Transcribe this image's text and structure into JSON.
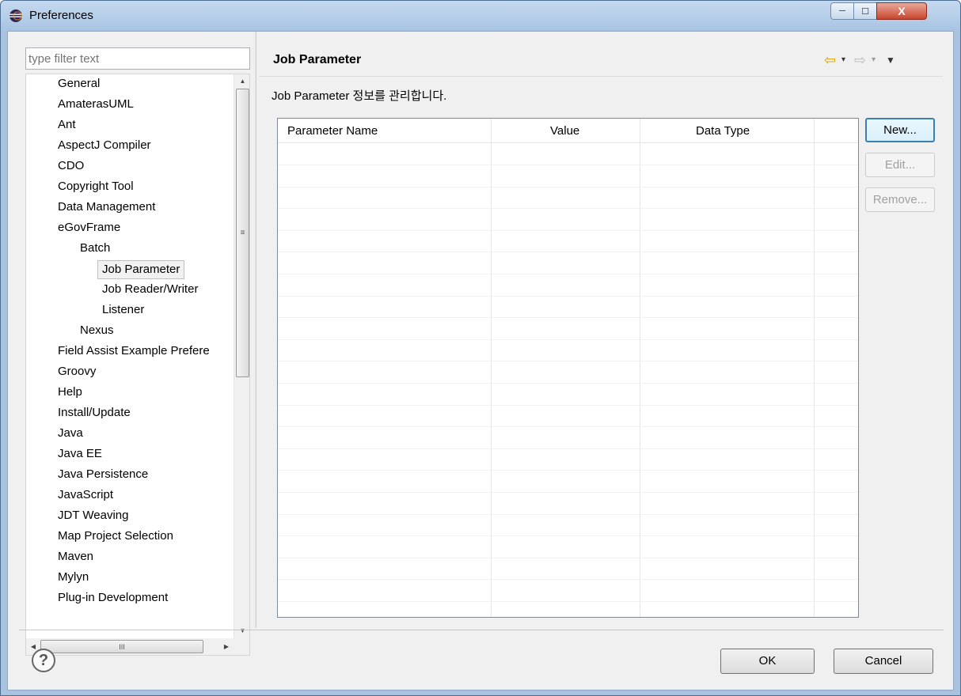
{
  "window": {
    "title": "Preferences",
    "controls": {
      "minimize": "─",
      "maximize": "☐",
      "close": "X"
    }
  },
  "filter": {
    "placeholder": "type filter text",
    "value": ""
  },
  "tree": {
    "items": [
      {
        "label": "General",
        "level": 0
      },
      {
        "label": "AmaterasUML",
        "level": 0
      },
      {
        "label": "Ant",
        "level": 0
      },
      {
        "label": "AspectJ Compiler",
        "level": 0
      },
      {
        "label": "CDO",
        "level": 0
      },
      {
        "label": "Copyright Tool",
        "level": 0
      },
      {
        "label": "Data Management",
        "level": 0
      },
      {
        "label": "eGovFrame",
        "level": 0
      },
      {
        "label": "Batch",
        "level": 1
      },
      {
        "label": "Job Parameter",
        "level": 2,
        "selected": true
      },
      {
        "label": "Job Reader/Writer",
        "level": 2
      },
      {
        "label": "Listener",
        "level": 2
      },
      {
        "label": "Nexus",
        "level": 1
      },
      {
        "label": "Field Assist Example Prefere",
        "level": 0
      },
      {
        "label": "Groovy",
        "level": 0
      },
      {
        "label": "Help",
        "level": 0
      },
      {
        "label": "Install/Update",
        "level": 0
      },
      {
        "label": "Java",
        "level": 0
      },
      {
        "label": "Java EE",
        "level": 0
      },
      {
        "label": "Java Persistence",
        "level": 0
      },
      {
        "label": "JavaScript",
        "level": 0
      },
      {
        "label": "JDT Weaving",
        "level": 0
      },
      {
        "label": "Map Project Selection",
        "level": 0
      },
      {
        "label": "Maven",
        "level": 0
      },
      {
        "label": "Mylyn",
        "level": 0
      },
      {
        "label": "Plug-in Development",
        "level": 0
      }
    ],
    "vscroll_grip": "≡",
    "hscroll_grip": "III"
  },
  "page": {
    "title": "Job Parameter",
    "description": "Job Parameter 정보를 관리합니다.",
    "nav": {
      "back": "⇦",
      "forward": "⇨",
      "dropdown": "▾",
      "menu": "▼"
    }
  },
  "table": {
    "columns": [
      "Parameter Name",
      "Value",
      "Data Type"
    ],
    "rows": []
  },
  "side_buttons": {
    "new": "New...",
    "edit": "Edit...",
    "remove": "Remove..."
  },
  "dialog": {
    "help": "?",
    "ok": "OK",
    "cancel": "Cancel"
  }
}
